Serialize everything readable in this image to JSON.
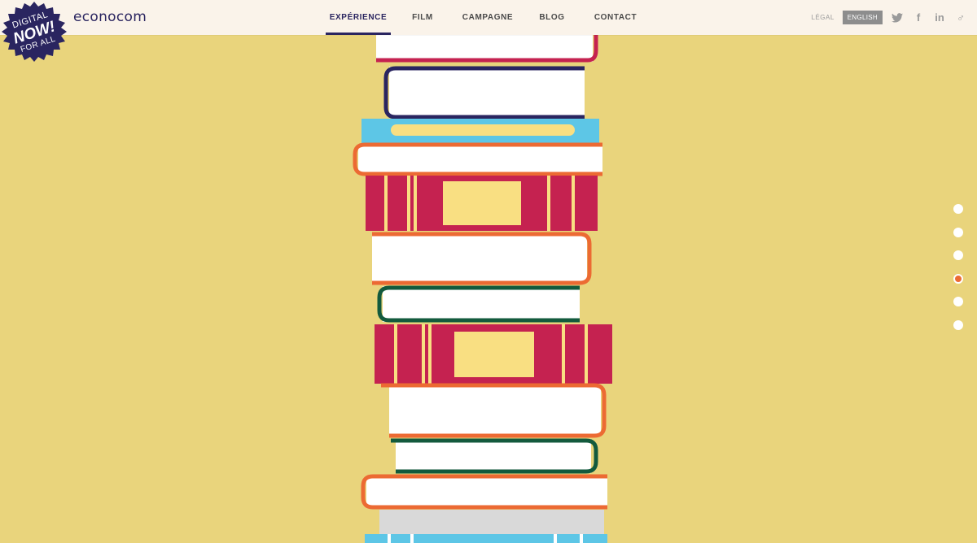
{
  "badge": {
    "line1": "DIGITAL",
    "line2": "NOW!",
    "line3": "FOR ALL"
  },
  "brand": {
    "name": "econocom"
  },
  "nav": {
    "items": [
      {
        "label": "EXPÉRIENCE",
        "active": true
      },
      {
        "label": "FILM",
        "active": false
      },
      {
        "label": "CAMPAGNE",
        "active": false
      },
      {
        "label": "BLOG",
        "active": false
      },
      {
        "label": "CONTACT",
        "active": false
      }
    ]
  },
  "util": {
    "legal": "LÉGAL",
    "language": "ENGLISH",
    "social": [
      {
        "icon": "twitter-icon"
      },
      {
        "icon": "facebook-icon",
        "glyph": "f"
      },
      {
        "icon": "linkedin-icon",
        "glyph": "in"
      },
      {
        "icon": "male-symbol-icon",
        "glyph": "♂"
      }
    ]
  },
  "pager": {
    "count": 6,
    "active_index": 3
  },
  "colors": {
    "background": "#e9d47c",
    "navy": "#2a2560",
    "crimson": "#c52250",
    "orange": "#ec6a33",
    "green": "#135a3d",
    "cyan": "#5dc6e6",
    "paper": "#ffffff",
    "label_yellow": "#f9df82",
    "grey": "#d9d9d9"
  }
}
